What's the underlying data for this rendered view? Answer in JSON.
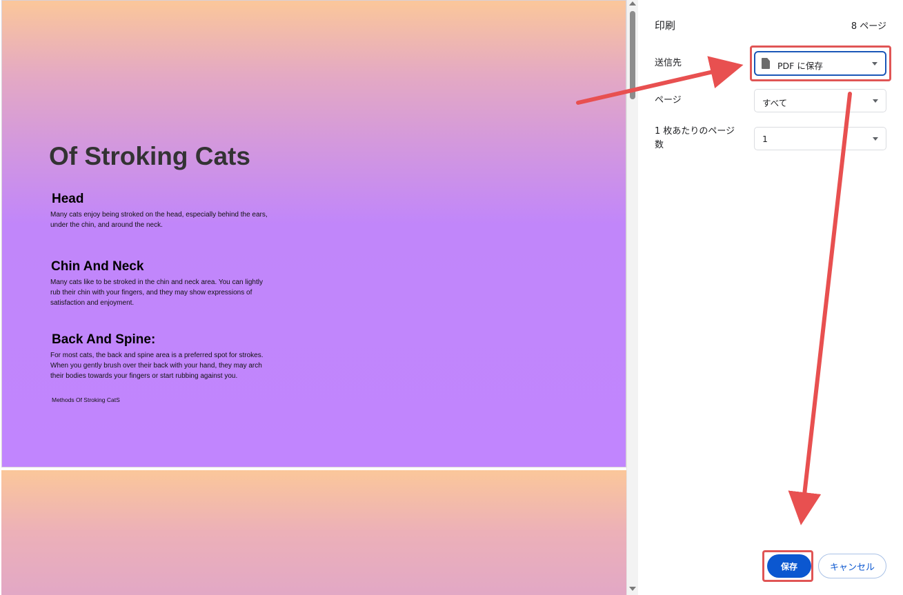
{
  "document": {
    "title": "Of Stroking Cats",
    "sections": [
      {
        "heading": "Head",
        "lines": [
          "Many cats enjoy being stroked on the head, especially behind the ears,",
          "under the chin, and around the neck."
        ]
      },
      {
        "heading": "Chin And Neck",
        "lines": [
          "Many cats like to be stroked in the chin and neck area. You can lightly",
          "rub their chin with your fingers, and they may show expressions of",
          "satisfaction and enjoyment."
        ]
      },
      {
        "heading": "Back And Spine:",
        "lines": [
          "For most cats, the back and spine area is a preferred spot for strokes.",
          "When you gently brush over their back with your hand, they may arch",
          "their bodies towards your fingers or start rubbing against you."
        ]
      }
    ],
    "footer": "Methods Of Stroking CatS"
  },
  "panel": {
    "title": "印刷",
    "page_count": "8 ページ",
    "destination": {
      "label": "送信先",
      "value": "PDF に保存",
      "icon": "document-icon"
    },
    "pages": {
      "label": "ページ",
      "value": "すべて"
    },
    "pages_per_sheet": {
      "label_line1": "1 枚あたりのページ",
      "label_line2": "数",
      "value": "1"
    },
    "save_label": "保存",
    "cancel_label": "キャンセル"
  },
  "colors": {
    "accent": "#0b57d0",
    "annotation": "#e05555",
    "page_gradient_top": "#fbc79a",
    "page_gradient_bottom": "#c185fe"
  }
}
